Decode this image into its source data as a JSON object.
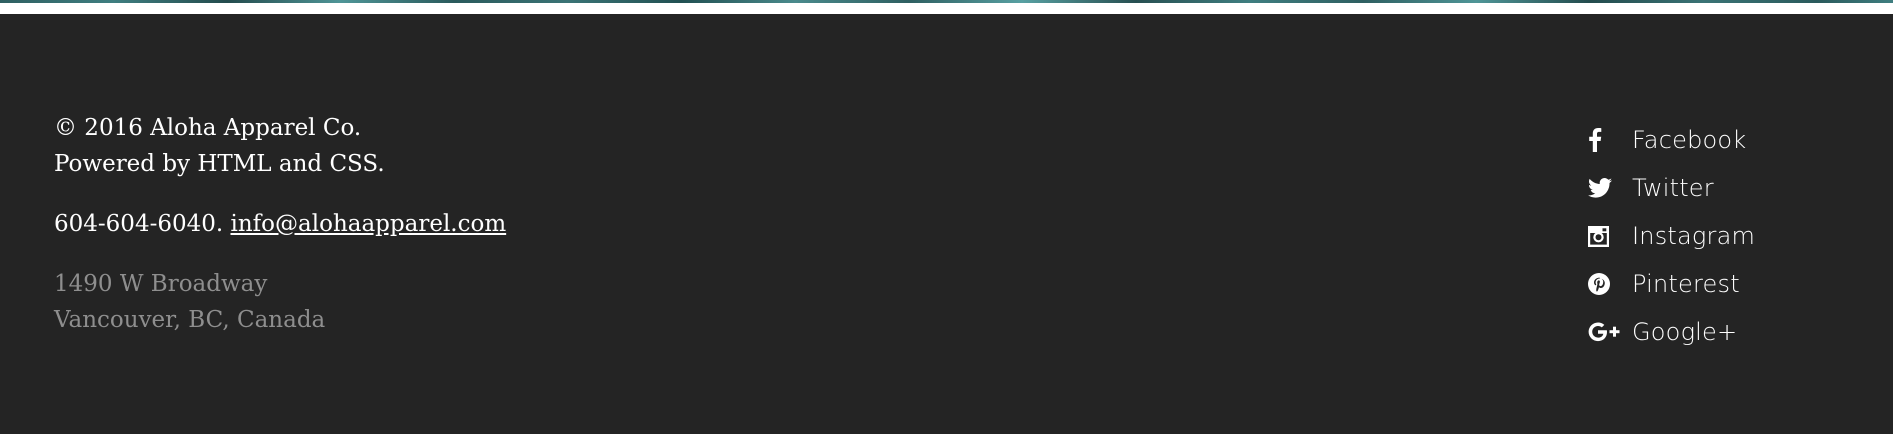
{
  "footer": {
    "copyright": "© 2016 Aloha Apparel Co.",
    "powered_by": "Powered by HTML and CSS.",
    "phone": "604-604-6040.",
    "email": "info@alohaapparel.com",
    "address_line1": "1490 W Broadway",
    "address_line2": "Vancouver, BC, Canada"
  },
  "social": {
    "items": [
      {
        "label": "Facebook",
        "icon": "facebook-icon"
      },
      {
        "label": "Twitter",
        "icon": "twitter-icon"
      },
      {
        "label": "Instagram",
        "icon": "instagram-icon"
      },
      {
        "label": "Pinterest",
        "icon": "pinterest-icon"
      },
      {
        "label": "Google+",
        "icon": "google-plus-icon"
      }
    ]
  },
  "colors": {
    "footer_background": "#242424",
    "text_primary": "#ffffff",
    "text_muted": "#8e8e8e",
    "banner_accent": "#3f7e80"
  }
}
